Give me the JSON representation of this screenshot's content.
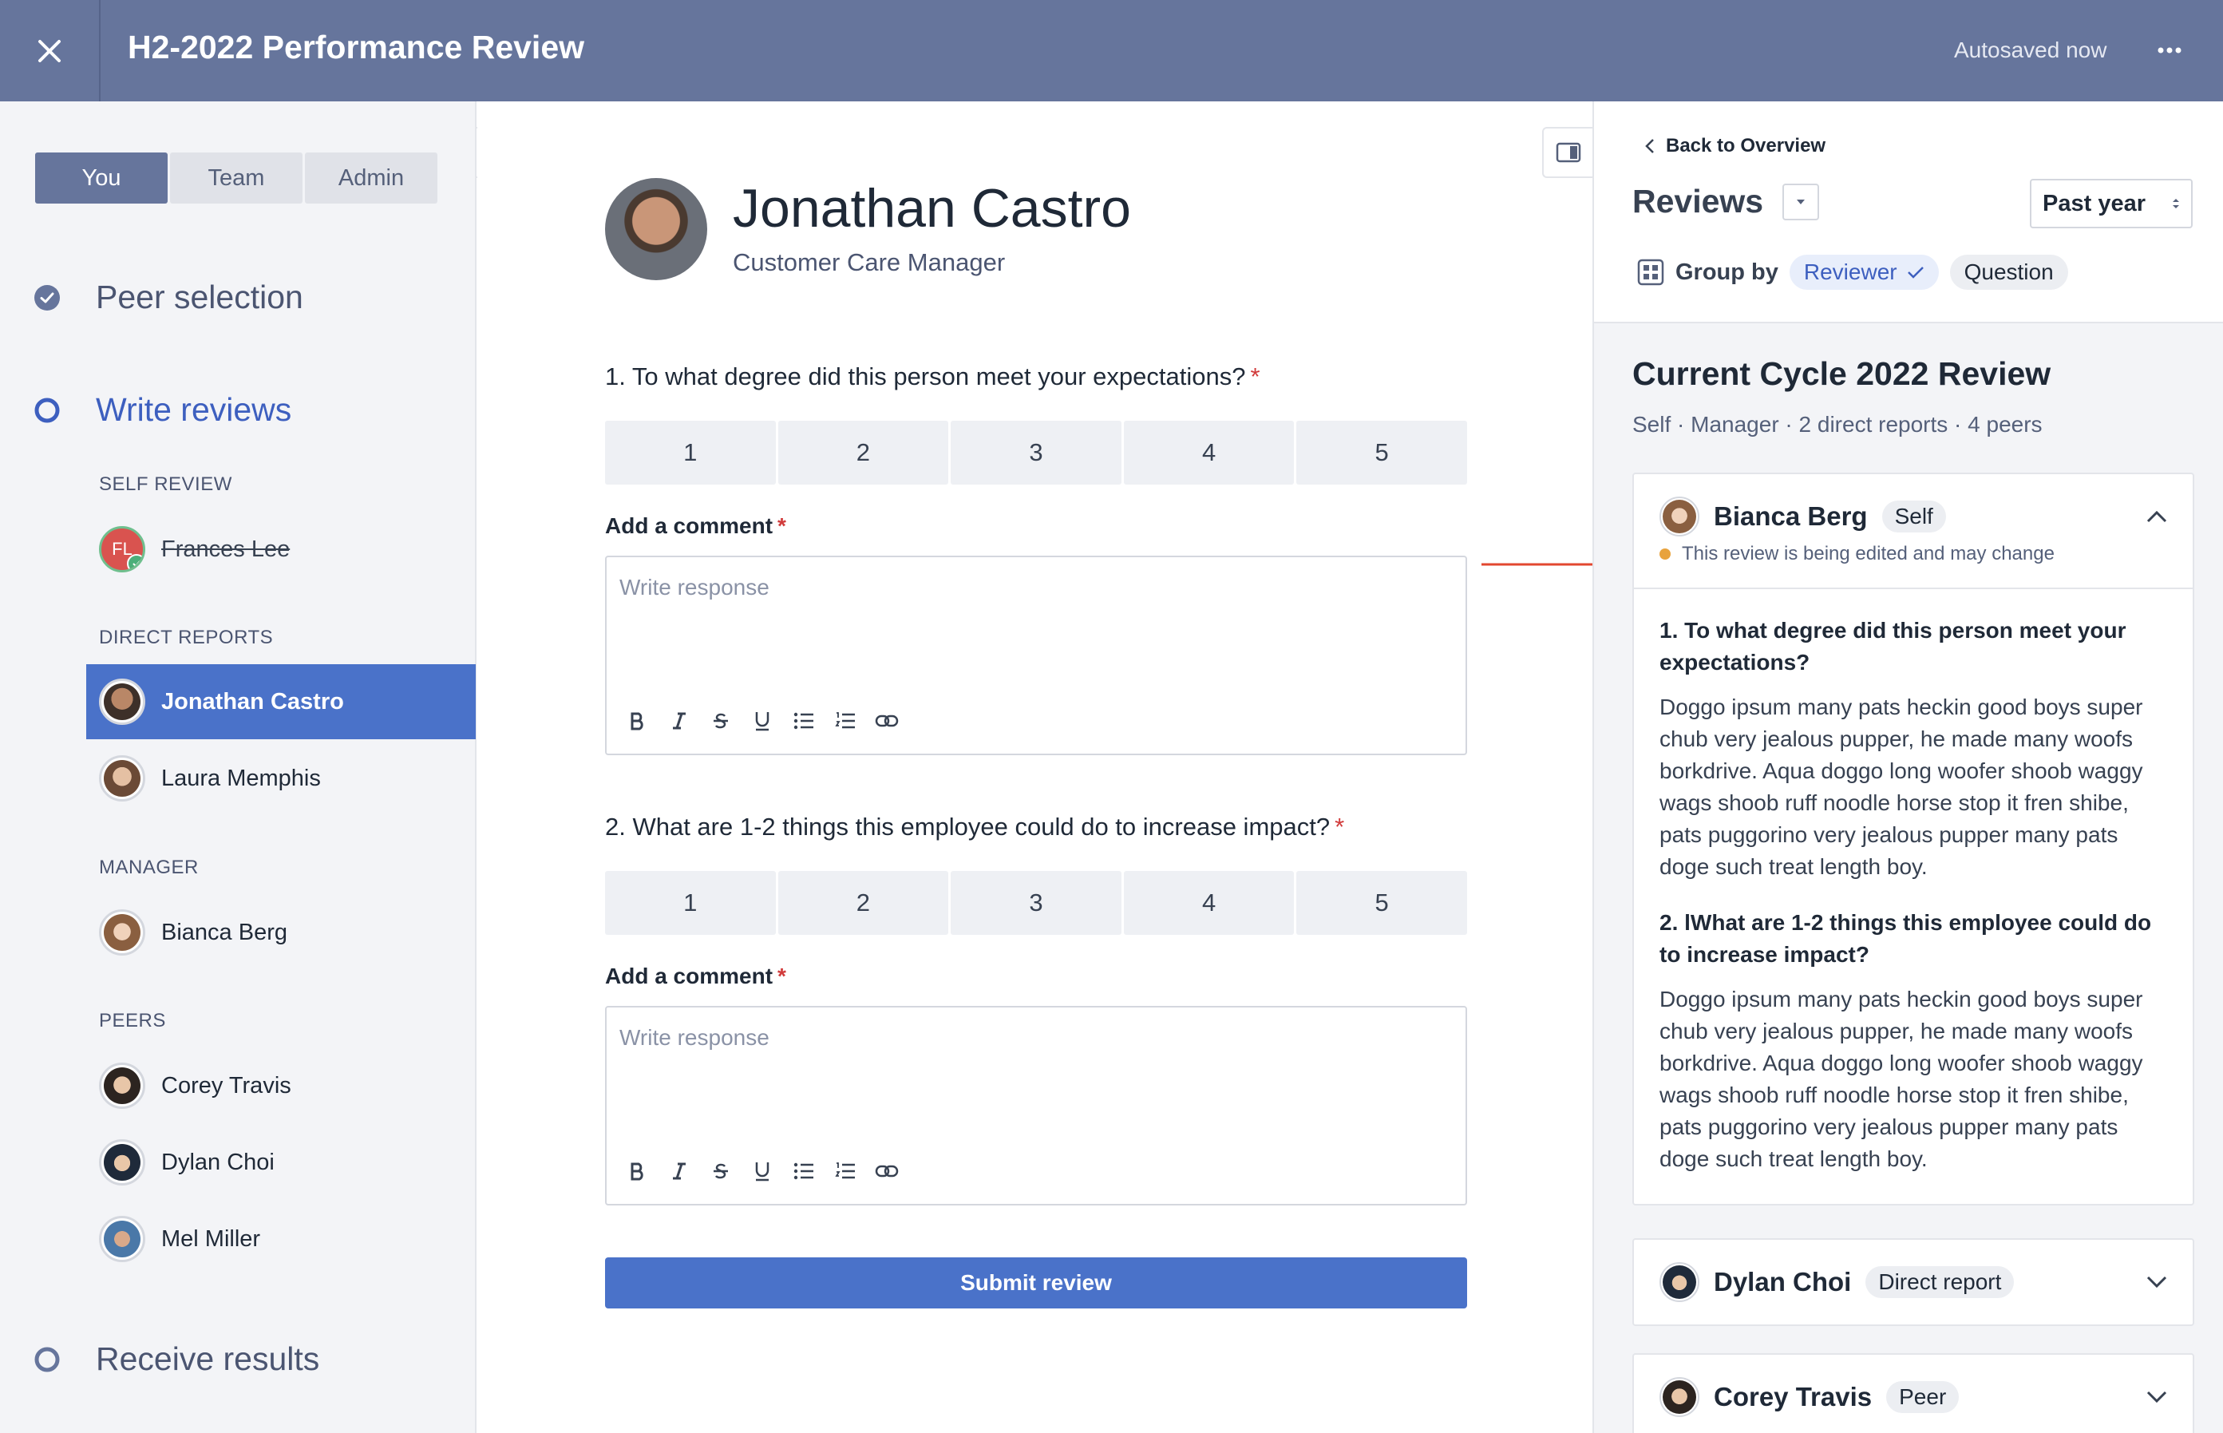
{
  "header": {
    "title": "H2-2022 Performance Review",
    "autosave": "Autosaved now"
  },
  "sidebar": {
    "tabs": [
      "You",
      "Team",
      "Admin"
    ],
    "steps": {
      "peer_selection": "Peer selection",
      "write_reviews": "Write reviews",
      "receive_results": "Receive results"
    },
    "sections": {
      "self_review": "SELF REVIEW",
      "direct_reports": "DIRECT REPORTS",
      "manager": "MANAGER",
      "peers": "PEERS"
    },
    "self": {
      "name": "Frances Lee",
      "initials": "FL"
    },
    "direct_reports": [
      "Jonathan Castro",
      "Laura Memphis"
    ],
    "manager": [
      "Bianca Berg"
    ],
    "peers": [
      "Corey Travis",
      "Dylan Choi",
      "Mel Miller"
    ]
  },
  "main": {
    "name": "Jonathan Castro",
    "role": "Customer Care Manager",
    "q1": "1. To what degree did this person meet your expectations?",
    "q2": "2. What are 1-2 things this employee could do to increase impact?",
    "required_mark": "*",
    "scale": [
      "1",
      "2",
      "3",
      "4",
      "5"
    ],
    "comment_label": "Add a comment",
    "placeholder": "Write response",
    "toolbar": [
      "bold-icon",
      "italic-icon",
      "strikethrough-icon",
      "underline-icon",
      "bullet-list-icon",
      "numbered-list-icon",
      "link-icon"
    ],
    "submit": "Submit review"
  },
  "right": {
    "back": "Back to Overview",
    "title": "Reviews",
    "period": "Past year",
    "group_by": "Group by",
    "chip_reviewer": "Reviewer",
    "chip_question": "Question",
    "cycle_title": "Current Cycle 2022 Review",
    "cycle_sub": "Self · Manager · 2 direct reports · 4 peers",
    "card1": {
      "name": "Bianca Berg",
      "tag": "Self",
      "status": "This review is being edited and may change",
      "q1": "1. To what degree did this person meet your expectations?",
      "a1": "Doggo ipsum many pats heckin good boys super chub very jealous pupper, he made many woofs borkdrive. Aqua doggo long woofer shoob waggy wags shoob ruff noodle horse stop it fren shibe, pats puggorino very jealous pupper many pats doge such treat length boy.",
      "q2": "2. lWhat are 1-2 things this employee could do to increase impact?",
      "a2": "Doggo ipsum many pats heckin good boys super chub very jealous pupper, he made many woofs borkdrive. Aqua doggo long woofer shoob waggy wags shoob ruff noodle horse stop it fren shibe, pats puggorino very jealous pupper many pats doge such treat length boy."
    },
    "card2": {
      "name": "Dylan Choi",
      "tag": "Direct report"
    },
    "card3": {
      "name": "Corey Travis",
      "tag": "Peer"
    }
  },
  "colors": {
    "header": "#66759c",
    "accent": "#4a72c9",
    "required": "#d13b3b",
    "editing_dot": "#e8a33d",
    "arrow": "#e2472f"
  }
}
